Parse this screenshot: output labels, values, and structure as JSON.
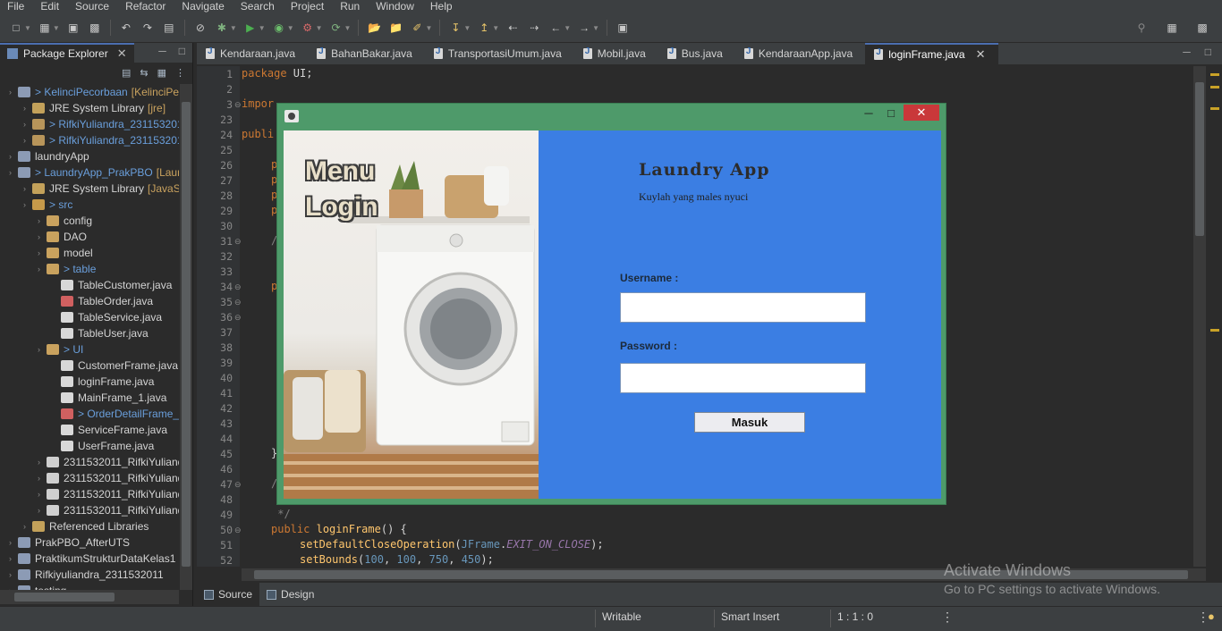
{
  "menubar": {
    "items": [
      "File",
      "Edit",
      "Source",
      "Refactor",
      "Navigate",
      "Search",
      "Project",
      "Run",
      "Window",
      "Help"
    ]
  },
  "package_explorer": {
    "tab_label": "Package Explorer",
    "tree": [
      {
        "label": "> KelinciPecorbaan",
        "suffix": "[KelinciPe",
        "depth": 0,
        "icon": "project"
      },
      {
        "label": "JRE System Library",
        "suffix": "[jre]",
        "depth": 1,
        "icon": "library"
      },
      {
        "label": "> RifkiYuliandra_231153201",
        "suffix": "",
        "depth": 1,
        "icon": "jar"
      },
      {
        "label": "> RifkiYuliandra_231153201",
        "suffix": "",
        "depth": 1,
        "icon": "jar"
      },
      {
        "label": "laundryApp",
        "suffix": "",
        "depth": 0,
        "icon": "project"
      },
      {
        "label": "> LaundryApp_PrakPBO",
        "suffix": "[Laur",
        "depth": 0,
        "icon": "project"
      },
      {
        "label": "JRE System Library",
        "suffix": "[JavaSE-",
        "depth": 1,
        "icon": "library"
      },
      {
        "label": "> src",
        "suffix": "",
        "depth": 1,
        "icon": "folder"
      },
      {
        "label": "config",
        "suffix": "",
        "depth": 2,
        "icon": "package"
      },
      {
        "label": "DAO",
        "suffix": "",
        "depth": 2,
        "icon": "package"
      },
      {
        "label": "model",
        "suffix": "",
        "depth": 2,
        "icon": "package"
      },
      {
        "label": "> table",
        "suffix": "",
        "depth": 2,
        "icon": "package"
      },
      {
        "label": "TableCustomer.java",
        "suffix": "",
        "depth": 3,
        "icon": "java"
      },
      {
        "label": "TableOrder.java",
        "suffix": "",
        "depth": 3,
        "icon": "java-error"
      },
      {
        "label": "TableService.java",
        "suffix": "",
        "depth": 3,
        "icon": "java"
      },
      {
        "label": "TableUser.java",
        "suffix": "",
        "depth": 3,
        "icon": "java"
      },
      {
        "label": "> UI",
        "suffix": "",
        "depth": 2,
        "icon": "package"
      },
      {
        "label": "CustomerFrame.java",
        "suffix": "",
        "depth": 3,
        "icon": "java"
      },
      {
        "label": "loginFrame.java",
        "suffix": "",
        "depth": 3,
        "icon": "java"
      },
      {
        "label": "MainFrame_1.java",
        "suffix": "",
        "depth": 3,
        "icon": "java"
      },
      {
        "label": "> OrderDetailFrame_",
        "suffix": "",
        "depth": 3,
        "icon": "java-error"
      },
      {
        "label": "ServiceFrame.java",
        "suffix": "",
        "depth": 3,
        "icon": "java"
      },
      {
        "label": "UserFrame.java",
        "suffix": "",
        "depth": 3,
        "icon": "java"
      },
      {
        "label": "2311532011_RifkiYuliand",
        "suffix": "",
        "depth": 2,
        "icon": "file"
      },
      {
        "label": "2311532011_RifkiYuliand",
        "suffix": "",
        "depth": 2,
        "icon": "file"
      },
      {
        "label": "2311532011_RifkiYuliand",
        "suffix": "",
        "depth": 2,
        "icon": "file"
      },
      {
        "label": "2311532011_RifkiYuliand",
        "suffix": "",
        "depth": 2,
        "icon": "file"
      },
      {
        "label": "Referenced Libraries",
        "suffix": "",
        "depth": 1,
        "icon": "library"
      },
      {
        "label": "PrakPBO_AfterUTS",
        "suffix": "",
        "depth": 0,
        "icon": "project"
      },
      {
        "label": "PraktikumStrukturDataKelas1",
        "suffix": "",
        "depth": 0,
        "icon": "project"
      },
      {
        "label": "Rifkiyuliandra_2311532011",
        "suffix": "",
        "depth": 0,
        "icon": "project"
      },
      {
        "label": "testing",
        "suffix": "",
        "depth": 0,
        "icon": "project"
      }
    ]
  },
  "editor": {
    "tabs": [
      "Kendaraan.java",
      "BahanBakar.java",
      "TransportasiUmum.java",
      "Mobil.java",
      "Bus.java",
      "KendaraanApp.java",
      "loginFrame.java"
    ],
    "active_tab": "loginFrame.java",
    "line_numbers": [
      "1",
      "2",
      "3",
      "23",
      "24",
      "25",
      "26",
      "27",
      "28",
      "29",
      "30",
      "31",
      "32",
      "33",
      "34",
      "35",
      "36",
      "37",
      "38",
      "39",
      "40",
      "41",
      "42",
      "43",
      "44",
      "45",
      "46",
      "47",
      "48",
      "49",
      "50",
      "51",
      "52"
    ],
    "code": {
      "l1_kw": "package",
      "l1_rest": " UI;",
      "l3_kw": "impor",
      "l24_kw": "publi",
      "l26": "p",
      "l27": "p",
      "l28": "p",
      "l29": "p",
      "l31": "/",
      "l34": "p",
      "l45": "}",
      "l47": "/",
      "l49": " */",
      "l50_kw": "public",
      "l50_mth": "loginFrame",
      "l50_rest": "() {",
      "l51_mth": "setDefaultCloseOperation",
      "l51_cls": "JFrame",
      "l51_const": "EXIT_ON_CLOSE",
      "l51_rest": ");",
      "l52_mth": "setBounds",
      "l52_nums": [
        "100",
        "100",
        "750",
        "450"
      ]
    },
    "bottom_tabs": [
      "Source",
      "Design"
    ]
  },
  "statusbar": {
    "writable": "Writable",
    "insert_mode": "Smart Insert",
    "position": "1 : 1 : 0"
  },
  "watermark": {
    "line1": "Activate Windows",
    "line2": "Go to PC settings to activate Windows."
  },
  "login_window": {
    "photo_title_line1": "Menu",
    "photo_title_line2": "Login",
    "app_title": "Laundry App",
    "app_subtitle": "Kuylah yang males nyuci",
    "username_label": "Username :",
    "username_value": "",
    "password_label": "Password :",
    "password_value": "",
    "submit_label": "Masuk",
    "form_bg_color": "#3b7ee3",
    "frame_border_color": "#4e9a6a",
    "close_color": "#c9383a"
  }
}
